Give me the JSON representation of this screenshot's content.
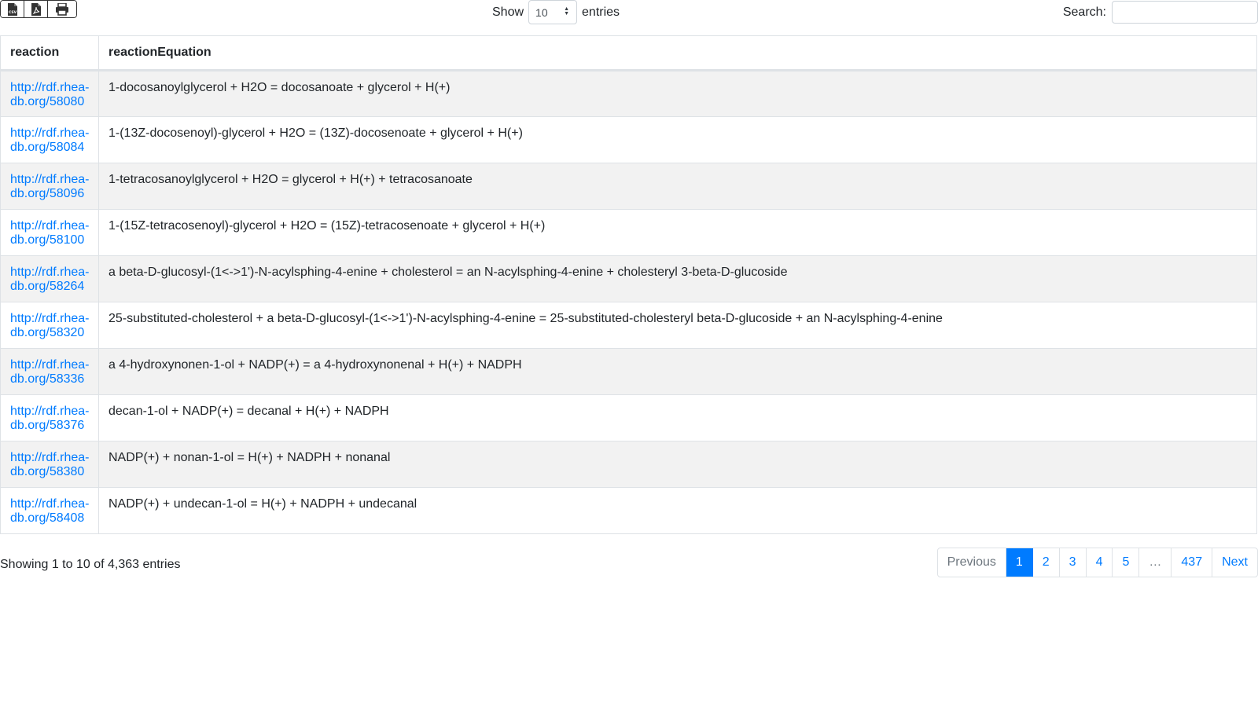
{
  "toolbar": {
    "buttons": [
      {
        "icon": "csv-file-icon"
      },
      {
        "icon": "pdf-file-icon"
      },
      {
        "icon": "print-icon"
      }
    ]
  },
  "length": {
    "show_label": "Show",
    "selected": "10",
    "entries_label": "entries"
  },
  "search": {
    "label": "Search:",
    "value": ""
  },
  "table": {
    "headers": [
      "reaction",
      "reactionEquation"
    ],
    "rows": [
      {
        "link": "http://rdf.rhea-db.org/58080",
        "eq": "1-docosanoylglycerol + H2O = docosanoate + glycerol + H(+)"
      },
      {
        "link": "http://rdf.rhea-db.org/58084",
        "eq": "1-(13Z-docosenoyl)-glycerol + H2O = (13Z)-docosenoate + glycerol + H(+)"
      },
      {
        "link": "http://rdf.rhea-db.org/58096",
        "eq": "1-tetracosanoylglycerol + H2O = glycerol + H(+) + tetracosanoate"
      },
      {
        "link": "http://rdf.rhea-db.org/58100",
        "eq": "1-(15Z-tetracosenoyl)-glycerol + H2O = (15Z)-tetracosenoate + glycerol + H(+)"
      },
      {
        "link": "http://rdf.rhea-db.org/58264",
        "eq": "a beta-D-glucosyl-(1<->1')-N-acylsphing-4-enine + cholesterol = an N-acylsphing-4-enine + cholesteryl 3-beta-D-glucoside"
      },
      {
        "link": "http://rdf.rhea-db.org/58320",
        "eq": "25-substituted-cholesterol + a beta-D-glucosyl-(1<->1')-N-acylsphing-4-enine = 25-substituted-cholesteryl beta-D-glucoside + an N-acylsphing-4-enine"
      },
      {
        "link": "http://rdf.rhea-db.org/58336",
        "eq": "a 4-hydroxynonen-1-ol + NADP(+) = a 4-hydroxynonenal + H(+) + NADPH"
      },
      {
        "link": "http://rdf.rhea-db.org/58376",
        "eq": "decan-1-ol + NADP(+) = decanal + H(+) + NADPH"
      },
      {
        "link": "http://rdf.rhea-db.org/58380",
        "eq": "NADP(+) + nonan-1-ol = H(+) + NADPH + nonanal"
      },
      {
        "link": "http://rdf.rhea-db.org/58408",
        "eq": "NADP(+) + undecan-1-ol = H(+) + NADPH + undecanal"
      }
    ]
  },
  "info": "Showing 1 to 10 of 4,363 entries",
  "pagination": {
    "previous": "Previous",
    "pages": [
      "1",
      "2",
      "3",
      "4",
      "5",
      "…",
      "437"
    ],
    "active": "1",
    "next": "Next"
  },
  "colors": {
    "link": "#007bff",
    "active": "#007bff"
  }
}
